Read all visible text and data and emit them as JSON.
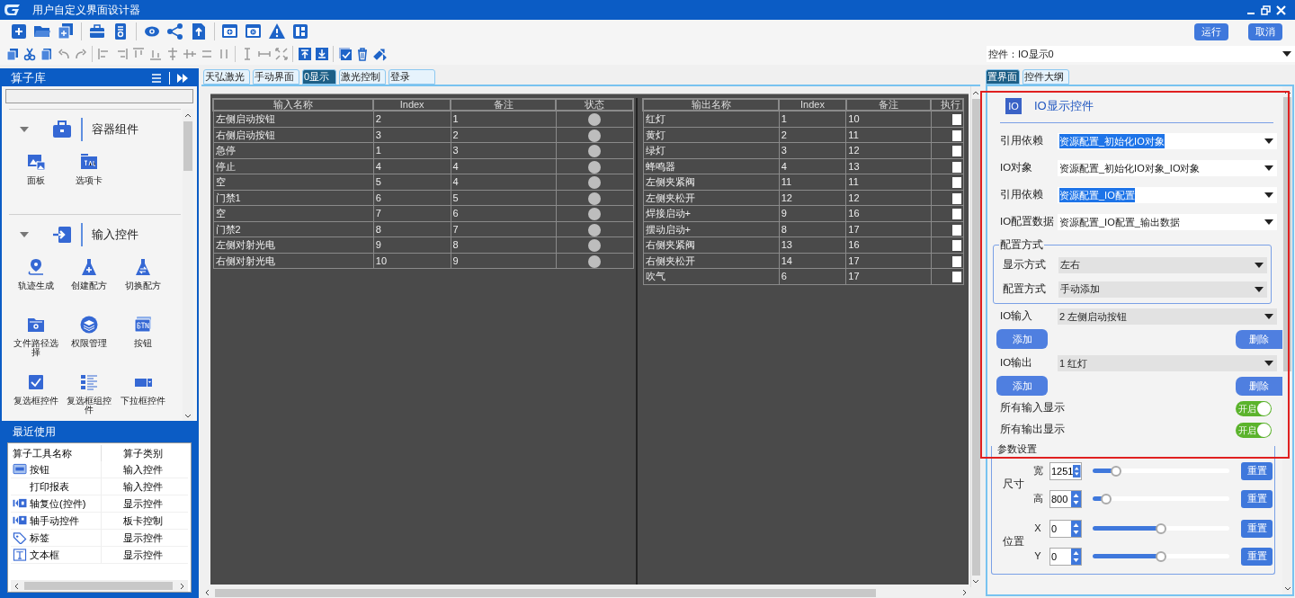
{
  "window": {
    "title": "用户自定义界面设计器"
  },
  "toolbar": {
    "run_button": "运行",
    "cancel_button": "取消"
  },
  "control_selector": {
    "value": "控件：IO显示0"
  },
  "library": {
    "title": "算子库",
    "sections": [
      {
        "title": "容器组件",
        "expanded": true,
        "items": [
          {
            "label": "面板"
          },
          {
            "label": "选项卡"
          }
        ]
      },
      {
        "title": "输入控件",
        "expanded": true,
        "items": [
          {
            "label": "轨迹生成"
          },
          {
            "label": "创建配方"
          },
          {
            "label": "切换配方"
          },
          {
            "label": "文件路径选择"
          },
          {
            "label": "权限管理"
          },
          {
            "label": "按钮"
          },
          {
            "label": "复选框控件"
          },
          {
            "label": "复选框组控件"
          },
          {
            "label": "下拉框控件"
          }
        ]
      }
    ]
  },
  "recent": {
    "title": "最近使用",
    "columns": [
      "算子工具名称",
      "算子类别"
    ],
    "rows": [
      {
        "name": "按钮",
        "category": "输入控件"
      },
      {
        "name": "打印报表",
        "category": "输入控件"
      },
      {
        "name": "轴复位(控件)",
        "category": "显示控件"
      },
      {
        "name": "轴手动控件",
        "category": "板卡控制"
      },
      {
        "name": "标签",
        "category": "显示控件"
      },
      {
        "name": "文本框",
        "category": "显示控件"
      }
    ]
  },
  "canvas_tabs": [
    {
      "label": "天弘激光",
      "selected": false
    },
    {
      "label": "手动界面",
      "selected": false
    },
    {
      "label": "0显示",
      "selected": true
    },
    {
      "label": "激光控制",
      "selected": false
    },
    {
      "label": "登录",
      "selected": false
    }
  ],
  "input_table": {
    "columns": [
      "输入名称",
      "Index",
      "备注",
      "状态"
    ],
    "rows": [
      {
        "name": "左侧启动按钮",
        "index": "2",
        "note": "1",
        "on": false
      },
      {
        "name": "右侧启动按钮",
        "index": "3",
        "note": "2",
        "on": false
      },
      {
        "name": "急停",
        "index": "1",
        "note": "3",
        "on": false
      },
      {
        "name": "停止",
        "index": "4",
        "note": "4",
        "on": false
      },
      {
        "name": "空",
        "index": "5",
        "note": "4",
        "on": false
      },
      {
        "name": "门禁1",
        "index": "6",
        "note": "5",
        "on": false
      },
      {
        "name": "空",
        "index": "7",
        "note": "6",
        "on": false
      },
      {
        "name": "门禁2",
        "index": "8",
        "note": "7",
        "on": false
      },
      {
        "name": "左侧对射光电",
        "index": "9",
        "note": "8",
        "on": false
      },
      {
        "name": "右侧对射光电",
        "index": "10",
        "note": "9",
        "on": false
      }
    ]
  },
  "output_table": {
    "columns": [
      "输出名称",
      "Index",
      "备注",
      "执行"
    ],
    "rows": [
      {
        "name": "红灯",
        "index": "1",
        "note": "10",
        "checked": false
      },
      {
        "name": "黄灯",
        "index": "2",
        "note": "11",
        "checked": false
      },
      {
        "name": "绿灯",
        "index": "3",
        "note": "12",
        "checked": false
      },
      {
        "name": "蜂鸣器",
        "index": "4",
        "note": "13",
        "checked": false
      },
      {
        "name": "左侧夹紧阀",
        "index": "11",
        "note": "11",
        "checked": false
      },
      {
        "name": "左侧夹松开",
        "index": "12",
        "note": "12",
        "checked": false
      },
      {
        "name": "焊接启动+",
        "index": "9",
        "note": "16",
        "checked": false
      },
      {
        "name": "摆动启动+",
        "index": "8",
        "note": "17",
        "checked": false
      },
      {
        "name": "右侧夹紧阀",
        "index": "13",
        "note": "16",
        "checked": false
      },
      {
        "name": "右侧夹松开",
        "index": "14",
        "note": "17",
        "checked": false
      },
      {
        "name": "吹气",
        "index": "6",
        "note": "17",
        "checked": false
      }
    ]
  },
  "panel_tabs": [
    {
      "label": "置界面",
      "selected": true
    },
    {
      "label": "控件大纲",
      "selected": false
    }
  ],
  "config": {
    "badge": "IO",
    "title": "IO显示控件",
    "fields": [
      {
        "label": "引用依赖",
        "value": "资源配置_初始化IO对象",
        "highlighted": true
      },
      {
        "label": "IO对象",
        "value": "资源配置_初始化IO对象_IO对象",
        "highlighted": false
      },
      {
        "label": "引用依赖",
        "value": "资源配置_IO配置",
        "highlighted": true
      },
      {
        "label": "IO配置数据",
        "value": "资源配置_IO配置_输出数据",
        "highlighted": false
      }
    ],
    "mode_group": {
      "title": "配置方式",
      "fields": [
        {
          "label": "显示方式",
          "value": "左右"
        },
        {
          "label": "配置方式",
          "value": "手动添加"
        }
      ]
    },
    "io_lists": [
      {
        "label": "IO输入",
        "value": "2  左侧启动按钮",
        "add_button": "添加",
        "delete_button": "删除"
      },
      {
        "label": "IO输出",
        "value": "1  红灯",
        "add_button": "添加",
        "delete_button": "删除"
      }
    ],
    "toggles": [
      {
        "label": "所有输入显示",
        "on": true,
        "text": "开启"
      },
      {
        "label": "所有输出显示",
        "on": true,
        "text": "开启"
      }
    ],
    "params": {
      "title": "参数设置",
      "groups": [
        {
          "label": "尺寸",
          "rows": [
            {
              "label": "宽",
              "value": "1251",
              "level": 0.17,
              "reset": "重置"
            },
            {
              "label": "高",
              "value": "800",
              "level": 0.1,
              "reset": "重置"
            }
          ]
        },
        {
          "label": "位置",
          "rows": [
            {
              "label": "X",
              "value": "0",
              "level": 0.5,
              "reset": "重置"
            },
            {
              "label": "Y",
              "value": "0",
              "level": 0.5,
              "reset": "重置"
            }
          ]
        }
      ]
    }
  }
}
